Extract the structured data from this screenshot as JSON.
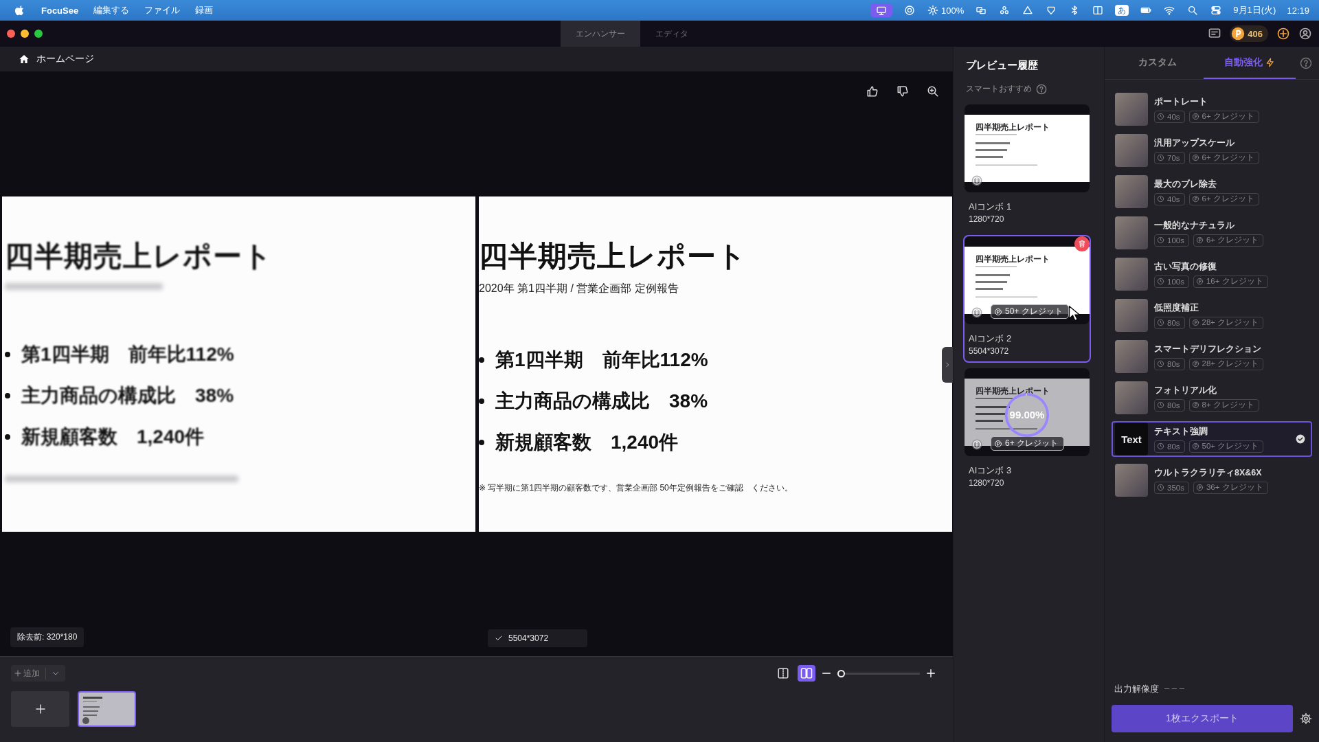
{
  "menubar": {
    "app": "FocuSee",
    "menus": [
      "編集する",
      "ファイル",
      "録画"
    ],
    "brightness": "100%",
    "input_source": "あ",
    "date": "9月1日(火)",
    "time": "12:19"
  },
  "titlebar": {
    "tabs": [
      {
        "label": "エンハンサー",
        "selected": true
      },
      {
        "label": "エディタ",
        "selected": false
      }
    ],
    "credits": "406"
  },
  "header": {
    "label": "ホームページ"
  },
  "canvas": {
    "before": {
      "title": "四半期売上レポート",
      "bullets": [
        "第1四半期　前年比112%",
        "主力商品の構成比　38%",
        "新規顧客数　1,240件"
      ]
    },
    "after": {
      "title": "四半期売上レポート",
      "subtitle": "2020年 第1四半期 / 営業企画部 定例報告",
      "bullets": [
        "第1四半期　前年比112%",
        "主力商品の構成比　38%",
        "新規顧客数　1,240件"
      ],
      "footnote": "※  写半期に第1四半期の顧客数です、営業企画部 50年定例報告をご確認　ください。"
    },
    "before_label": "除去前: 320*180",
    "after_label": "5504*3072"
  },
  "bottom": {
    "add_label": "追加",
    "view_modes": [
      {
        "kind": "single",
        "selected": false
      },
      {
        "kind": "split",
        "selected": true
      }
    ],
    "zoom": {
      "level": 0.05
    },
    "thumbnails": [
      {
        "selected": true
      }
    ]
  },
  "preview": {
    "title": "プレビュー履歴",
    "subtitle": "スマートおすすめ",
    "cards": [
      {
        "name": "AIコンボ 1",
        "size": "1280*720",
        "selected": false,
        "thumb_title": "四半期売上レポート"
      },
      {
        "name": "AIコンボ 2",
        "size": "5504*3072",
        "selected": true,
        "thumb_title": "四半期売上レポート",
        "credit": "50+ クレジット"
      },
      {
        "name": "AIコンボ 3",
        "size": "1280*720",
        "selected": false,
        "thumb_title": "四半期売上レポート",
        "credit": "6+ クレジット",
        "progress": {
          "level": 0.99,
          "label": "99.00%"
        }
      }
    ]
  },
  "presets": {
    "tabs": [
      {
        "label": "カスタム",
        "selected": false
      },
      {
        "label": "自動強化",
        "selected": true
      }
    ],
    "items": [
      {
        "kind": "photo",
        "name": "ポートレート",
        "time": "40s",
        "credit": "6+ クレジット",
        "selected": false
      },
      {
        "kind": "photo",
        "name": "汎用アップスケール",
        "time": "70s",
        "credit": "6+ クレジット",
        "selected": false
      },
      {
        "kind": "photo",
        "name": "最大のブレ除去",
        "time": "40s",
        "credit": "6+ クレジット",
        "selected": false
      },
      {
        "kind": "photo",
        "name": "一般的なナチュラル",
        "time": "100s",
        "credit": "6+ クレジット",
        "selected": false
      },
      {
        "kind": "photo",
        "name": "古い写真の修復",
        "time": "100s",
        "credit": "16+ クレジット",
        "selected": false
      },
      {
        "kind": "photo",
        "name": "低照度補正",
        "time": "80s",
        "credit": "28+ クレジット",
        "selected": false
      },
      {
        "kind": "photo",
        "name": "スマートデリフレクション",
        "time": "80s",
        "credit": "28+ クレジット",
        "selected": false
      },
      {
        "kind": "photo",
        "name": "フォトリアル化",
        "time": "80s",
        "credit": "8+ クレジット",
        "selected": false
      },
      {
        "kind": "text",
        "name": "テキスト強調",
        "time": "80s",
        "credit": "50+ クレジット",
        "selected": true,
        "thumb_text": "Text"
      },
      {
        "kind": "photo",
        "name": "ウルトラクラリティ8X&6X",
        "time": "350s",
        "credit": "36+ クレジット",
        "selected": false
      }
    ],
    "output_label": "出力解像度",
    "output_value": "– – –",
    "export_label": "1枚エクスポート"
  }
}
